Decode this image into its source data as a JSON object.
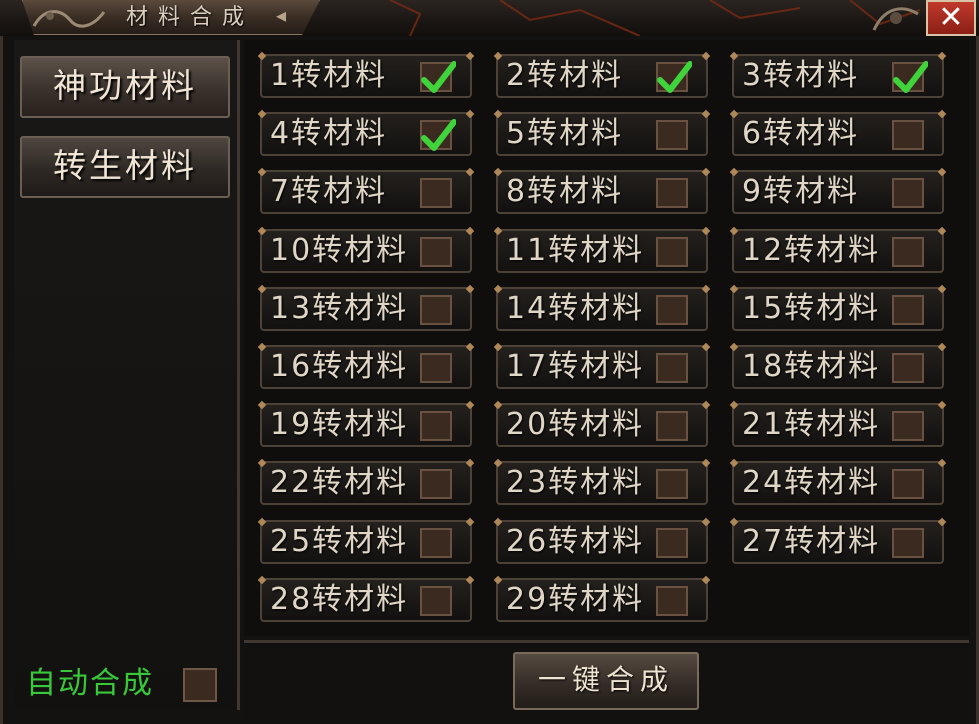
{
  "window": {
    "title": "材料合成",
    "close_label": "✕"
  },
  "sidebar": {
    "items": [
      {
        "label": "神功材料"
      },
      {
        "label": "转生材料"
      }
    ]
  },
  "materials": [
    {
      "label": "1转材料",
      "checked": true
    },
    {
      "label": "2转材料",
      "checked": true
    },
    {
      "label": "3转材料",
      "checked": true
    },
    {
      "label": "4转材料",
      "checked": true
    },
    {
      "label": "5转材料",
      "checked": false
    },
    {
      "label": "6转材料",
      "checked": false
    },
    {
      "label": "7转材料",
      "checked": false
    },
    {
      "label": "8转材料",
      "checked": false
    },
    {
      "label": "9转材料",
      "checked": false
    },
    {
      "label": "10转材料",
      "checked": false
    },
    {
      "label": "11转材料",
      "checked": false
    },
    {
      "label": "12转材料",
      "checked": false
    },
    {
      "label": "13转材料",
      "checked": false
    },
    {
      "label": "14转材料",
      "checked": false
    },
    {
      "label": "15转材料",
      "checked": false
    },
    {
      "label": "16转材料",
      "checked": false
    },
    {
      "label": "17转材料",
      "checked": false
    },
    {
      "label": "18转材料",
      "checked": false
    },
    {
      "label": "19转材料",
      "checked": false
    },
    {
      "label": "20转材料",
      "checked": false
    },
    {
      "label": "21转材料",
      "checked": false
    },
    {
      "label": "22转材料",
      "checked": false
    },
    {
      "label": "23转材料",
      "checked": false
    },
    {
      "label": "24转材料",
      "checked": false
    },
    {
      "label": "25转材料",
      "checked": false
    },
    {
      "label": "26转材料",
      "checked": false
    },
    {
      "label": "27转材料",
      "checked": false
    },
    {
      "label": "28转材料",
      "checked": false
    },
    {
      "label": "29转材料",
      "checked": false
    }
  ],
  "footer": {
    "auto_label": "自动合成",
    "auto_checked": false,
    "combine_label": "一键合成"
  },
  "colors": {
    "check_green": "#3fd43b",
    "auto_text": "#39c83a",
    "close_red": "#c0392b"
  },
  "icons": {
    "check": "checkmark-icon",
    "close": "close-icon"
  }
}
